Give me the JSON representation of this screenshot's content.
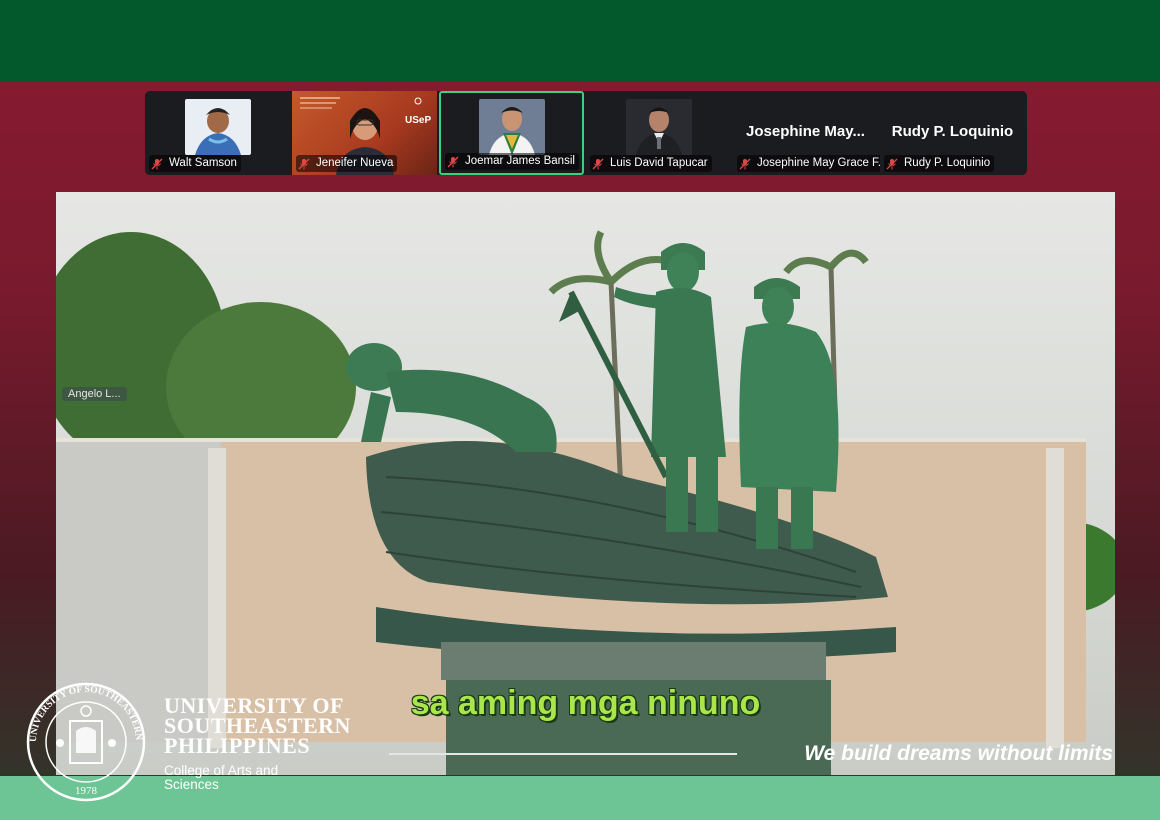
{
  "participants": [
    {
      "name": "Walt Samson",
      "display": "photo"
    },
    {
      "name": "Jeneifer Nueva",
      "display": "video"
    },
    {
      "name": "Joemar James Bansil",
      "display": "photo",
      "active": true
    },
    {
      "name": "Luis David Tapucar",
      "display": "photo"
    },
    {
      "name": "Josephine May Grace F...",
      "display": "name",
      "big_name": "Josephine  May..."
    },
    {
      "name": "Rudy P. Loquinio",
      "display": "name",
      "big_name": "Rudy P. Loquinio"
    }
  ],
  "video": {
    "caption": "sa aming mga ninuno",
    "participant_tag": "Angelo L...",
    "tagline": "We build dreams without limits"
  },
  "branding": {
    "university_line1": "UNIVERSITY OF",
    "university_line2": "SOUTHEASTERN",
    "university_line3": "PHILIPPINES",
    "college_line1": "College of Arts and",
    "college_line2": "Sciences",
    "seal_text": "UNIVERSITY OF SOUTHEASTERN PHILIPPINES",
    "seal_year": "1978",
    "slide_logo_text": "USeP"
  },
  "colors": {
    "top_band": "#03592b",
    "maroon": "#8a1a30",
    "bottom_band": "#6dc595",
    "active_border": "#39d17b",
    "caption": "#a9e64a",
    "muted_mic": "#e04848"
  },
  "icons": {
    "mic": "microphone-muted-icon"
  }
}
